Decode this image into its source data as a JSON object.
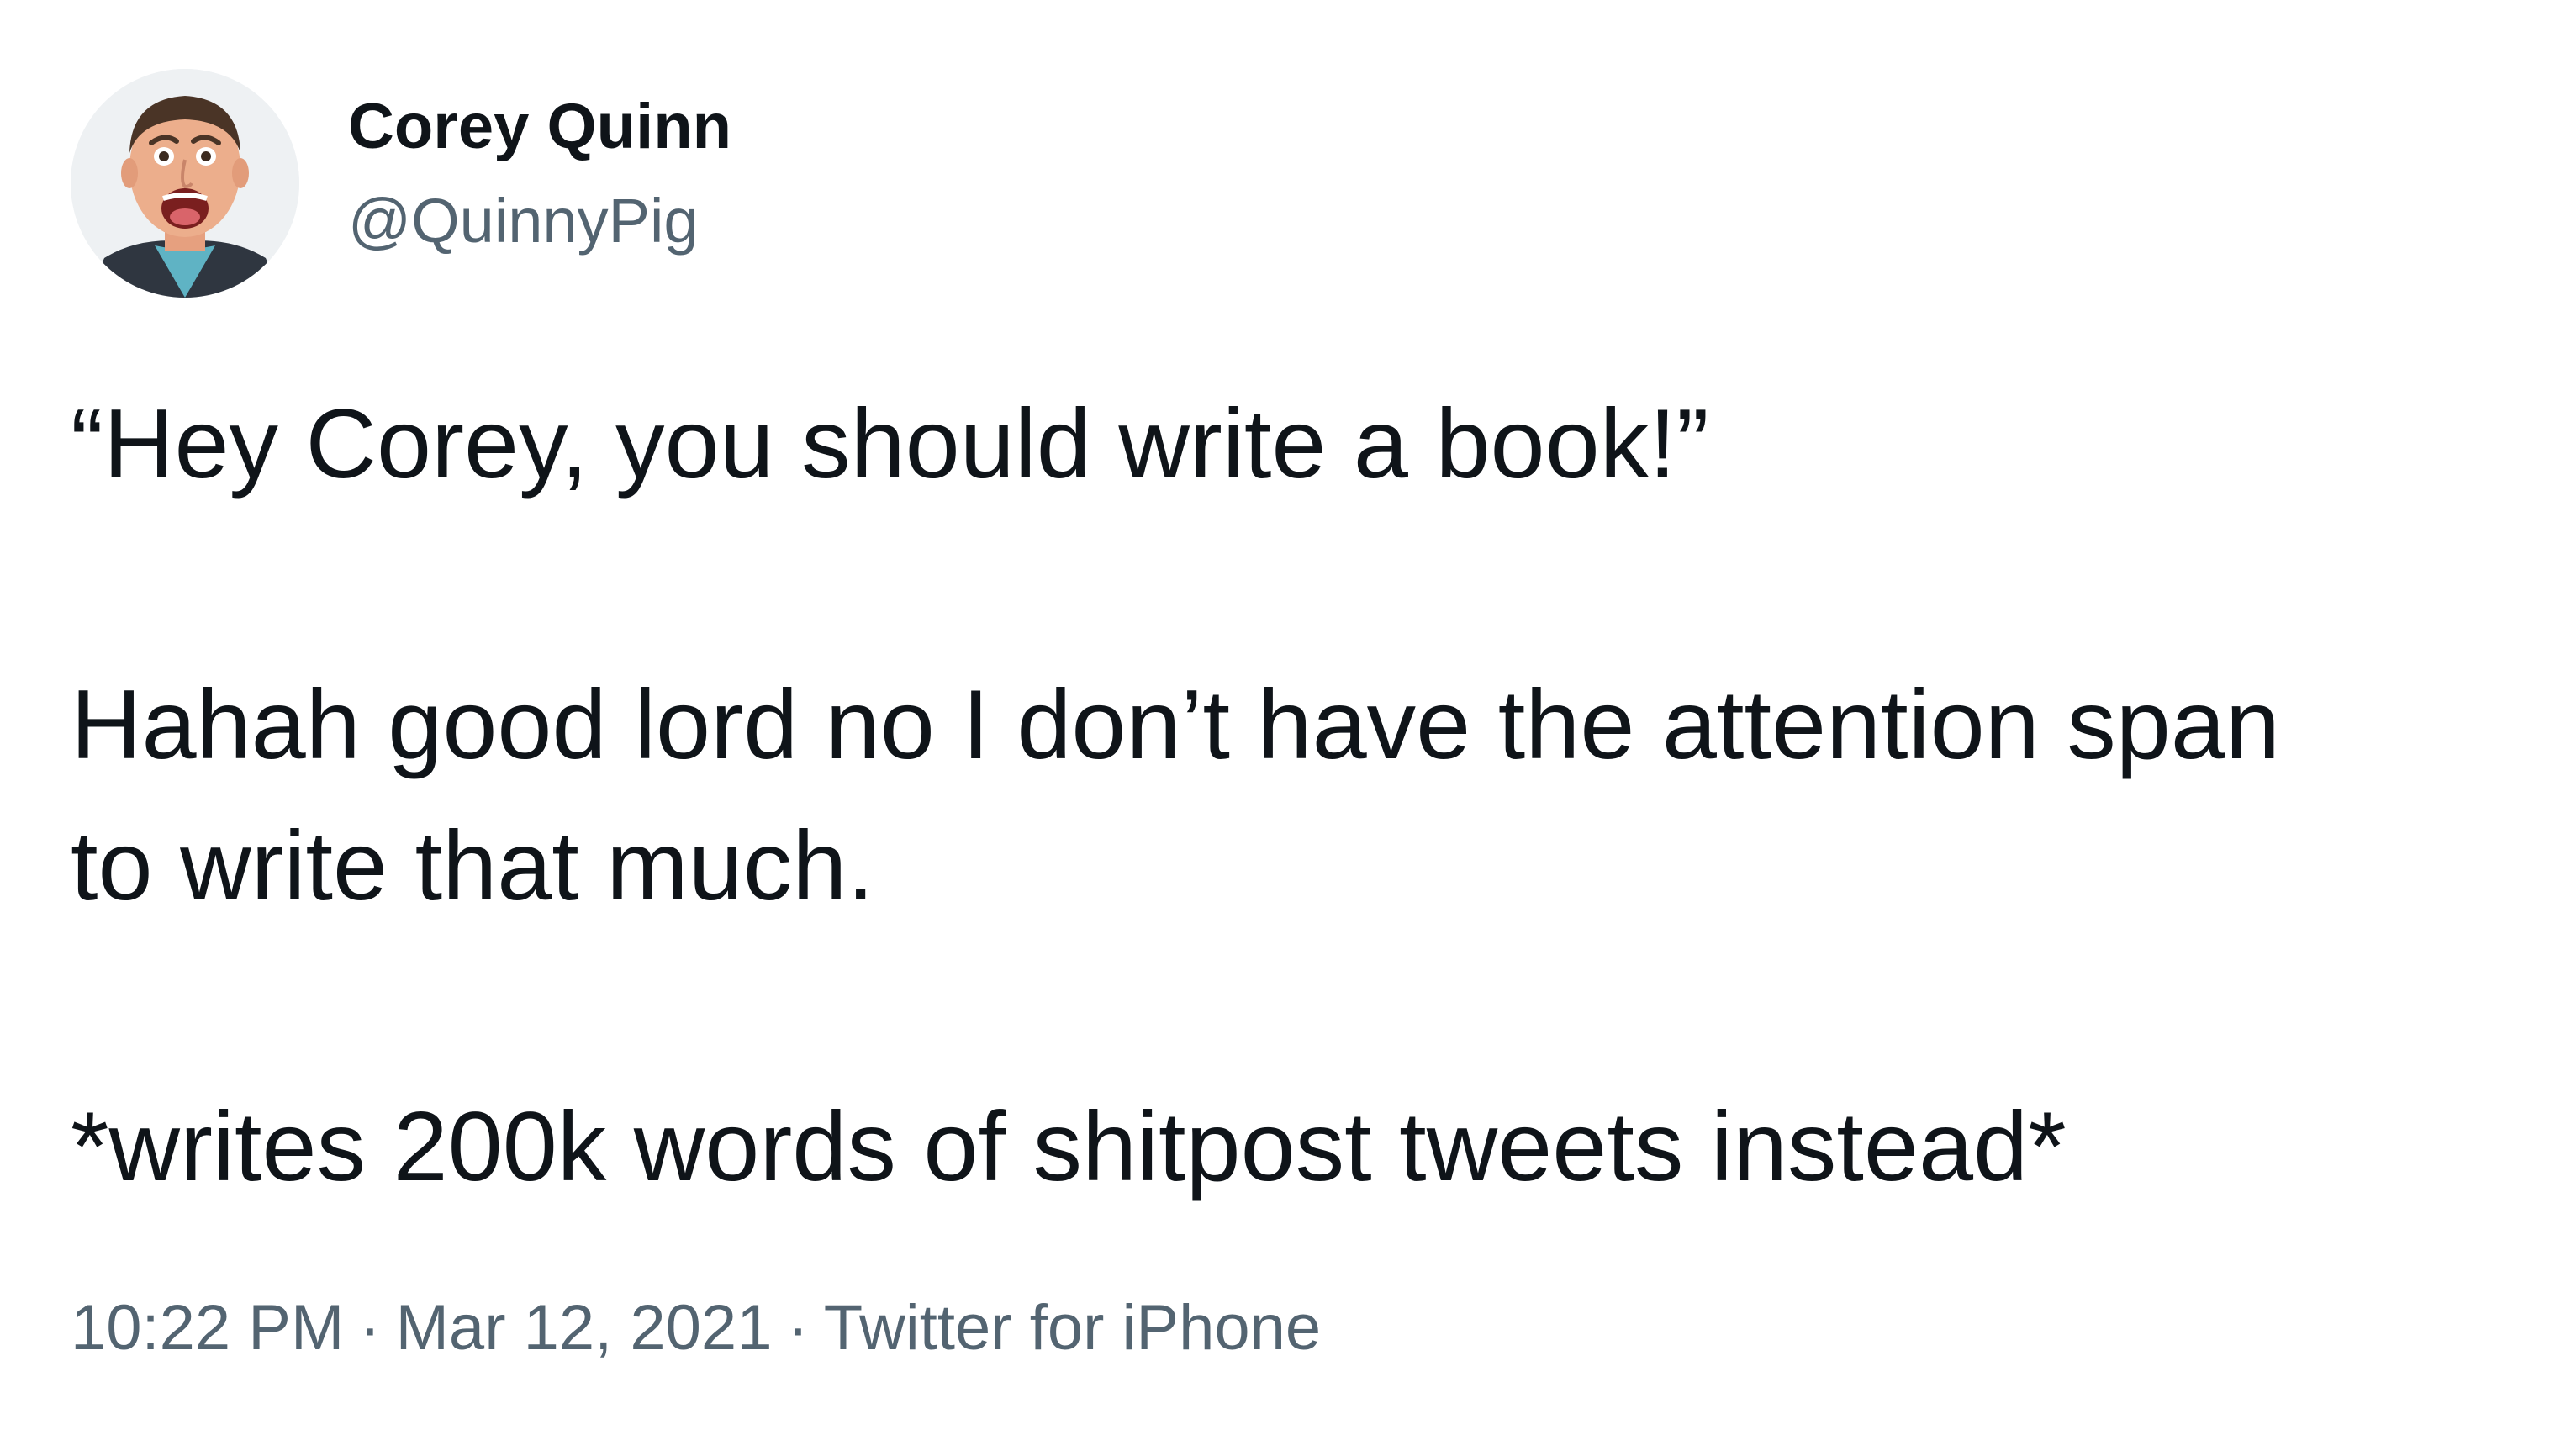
{
  "author": {
    "display_name": "Corey Quinn",
    "handle": "@QuinnyPig"
  },
  "tweet": {
    "lines": [
      "“Hey Corey, you should write a book!”",
      "Hahah good lord no I don’t have the attention span",
      "to write that much.",
      "*writes 200k words of shitpost tweets instead*"
    ],
    "time": "10:22 PM",
    "date": "Mar 12, 2021",
    "source": "Twitter for iPhone",
    "separator": "·"
  },
  "colors": {
    "text": "#0f1419",
    "secondary": "#536471",
    "background": "#ffffff"
  }
}
